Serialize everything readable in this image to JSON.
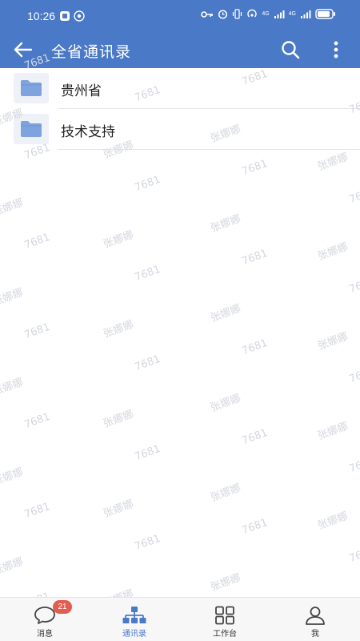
{
  "status_bar": {
    "time": "10:26",
    "net_label_1": "4G",
    "net_label_2": "4G"
  },
  "app_bar": {
    "title": "全省通讯录"
  },
  "list": {
    "items": [
      {
        "label": "贵州省",
        "icon": "folder-icon"
      },
      {
        "label": "技术支持",
        "icon": "folder-icon"
      }
    ]
  },
  "watermark": {
    "name": "张娜娜",
    "code": "7681"
  },
  "bottom_nav": {
    "items": [
      {
        "label": "消息",
        "icon": "chat-bubble-icon",
        "badge": "21"
      },
      {
        "label": "通讯录",
        "icon": "org-chart-icon"
      },
      {
        "label": "工作台",
        "icon": "grid-icon"
      },
      {
        "label": "我",
        "icon": "person-icon"
      }
    ]
  },
  "colors": {
    "primary": "#4a79c7",
    "folder": "#7fa3de",
    "badge": "#e05d4f",
    "watermark": "#d4d7de"
  }
}
